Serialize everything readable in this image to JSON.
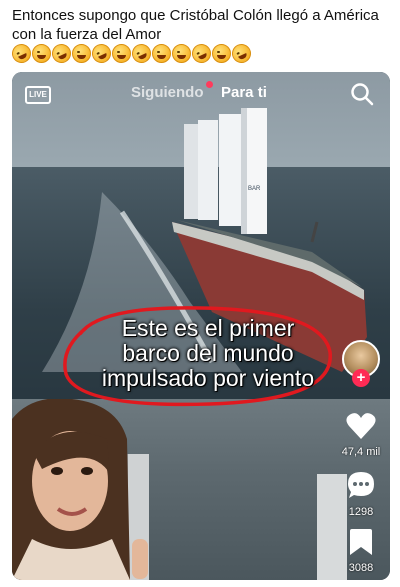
{
  "post": {
    "caption": "Entonces supongo que Cristóbal Colón llegó a América con la fuerza del Amor",
    "emojis": [
      "rolling-on-floor-laughing",
      "joy",
      "rolling-on-floor-laughing",
      "joy",
      "rolling-on-floor-laughing",
      "joy",
      "rolling-on-floor-laughing",
      "joy",
      "joy",
      "rolling-on-floor-laughing",
      "joy",
      "rolling-on-floor-laughing"
    ]
  },
  "tiktok": {
    "live_label": "LIVE",
    "tabs": {
      "following": "Siguiendo",
      "for_you": "Para ti"
    },
    "overlay_lines": [
      "Este es el primer",
      "barco del mundo",
      "impulsado por viento"
    ],
    "likes": "47,4 mil",
    "comments": "1298",
    "saves": "3088"
  },
  "colors": {
    "accent_red": "#ff2b55",
    "annotation_red": "#e0191f",
    "text_white": "#ffffff"
  }
}
